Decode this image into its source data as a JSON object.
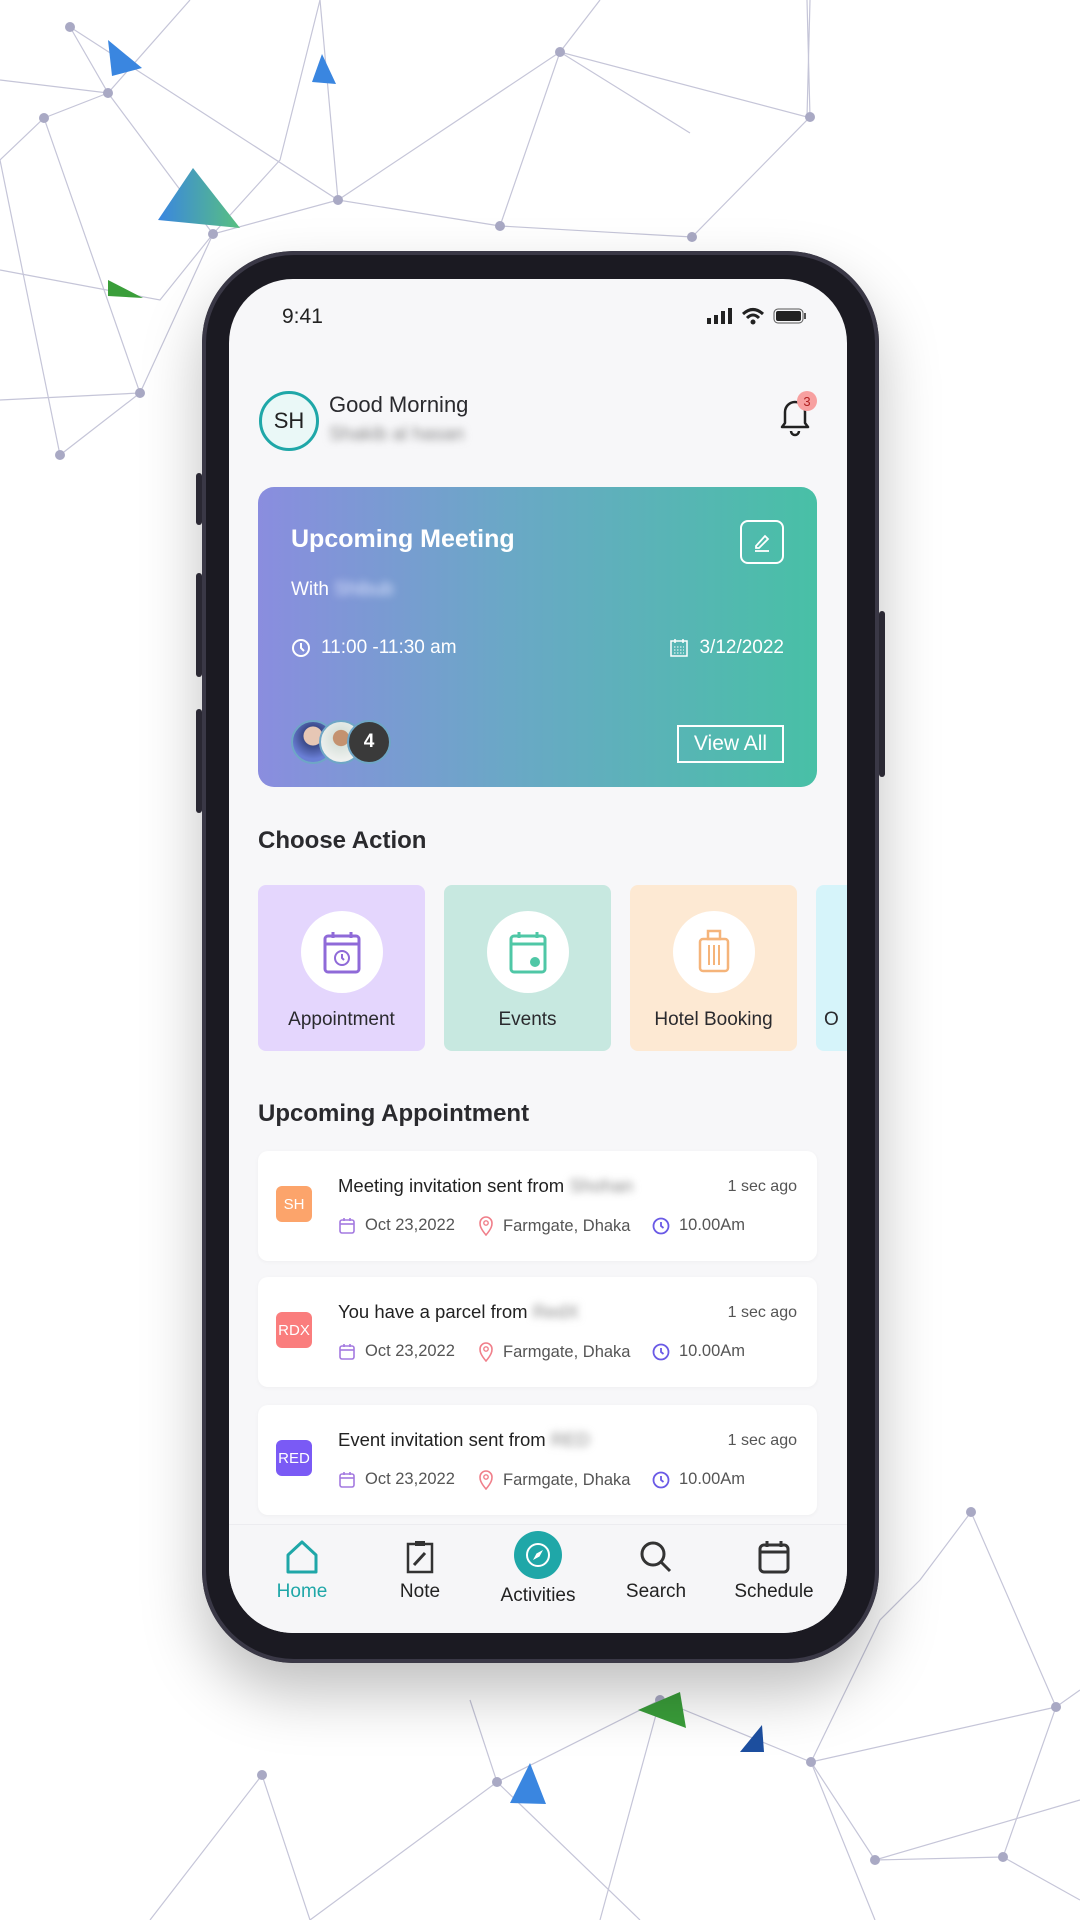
{
  "status_bar": {
    "time": "9:41"
  },
  "header": {
    "avatar_initials": "SH",
    "greeting": "Good Morning",
    "user_name": "Shakib al hasan",
    "notification_count": "3"
  },
  "meeting_card": {
    "title": "Upcoming Meeting",
    "with_label": "With",
    "with_name": "Shibub",
    "time": "11:00 -11:30 am",
    "date": "3/12/2022",
    "extra_participants": "4",
    "view_all": "View All"
  },
  "choose_action": {
    "heading": "Choose Action",
    "items": [
      {
        "label": "Appointment",
        "bg": "#e4d6fd",
        "color": "#8f6ad8"
      },
      {
        "label": "Events",
        "bg": "#c7e8e0",
        "color": "#4fc7a6"
      },
      {
        "label": "Hotel Booking",
        "bg": "#fde9d3",
        "color": "#f5b47a"
      },
      {
        "label": "O",
        "bg": "#d6f4fa",
        "color": "#4fc1d6"
      }
    ]
  },
  "appointments": {
    "heading": "Upcoming Appointment",
    "items": [
      {
        "tag": "SH",
        "tag_color": "#fca46b",
        "message": "Meeting invitation sent from",
        "sender": "Shohan",
        "ago": "1 sec ago",
        "date": "Oct 23,2022",
        "location": "Farmgate, Dhaka",
        "time": "10.00Am"
      },
      {
        "tag": "RDX",
        "tag_color": "#fa7d7d",
        "message": "You have a parcel from",
        "sender": "RedX",
        "ago": "1 sec ago",
        "date": "Oct 23,2022",
        "location": "Farmgate, Dhaka",
        "time": "10.00Am"
      },
      {
        "tag": "RED",
        "tag_color": "#7a5af5",
        "message": "Event invitation sent from",
        "sender": "RED",
        "ago": "1 sec ago",
        "date": "Oct 23,2022",
        "location": "Farmgate, Dhaka",
        "time": "10.00Am"
      }
    ]
  },
  "bottom_nav": {
    "active": "Home",
    "accent": "#1fa7a8",
    "items": [
      {
        "label": "Home"
      },
      {
        "label": "Note"
      },
      {
        "label": "Activities"
      },
      {
        "label": "Search"
      },
      {
        "label": "Schedule"
      }
    ]
  }
}
